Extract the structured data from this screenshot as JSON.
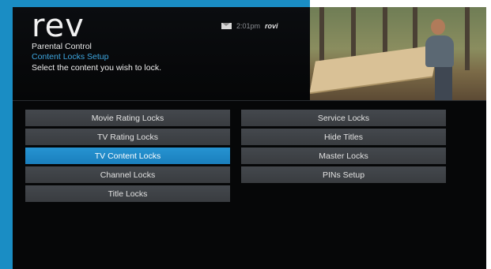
{
  "app": {
    "logo": "rev"
  },
  "header": {
    "breadcrumb_title": "Parental Control",
    "breadcrumb_subtitle": "Content Locks Setup",
    "instruction": "Select the content you wish to lock."
  },
  "status": {
    "time": "2:01pm",
    "brand": "rovi",
    "mail_icon": "mail-icon"
  },
  "menu": {
    "left": [
      {
        "label": "Movie Rating Locks",
        "selected": false
      },
      {
        "label": "TV Rating Locks",
        "selected": false
      },
      {
        "label": "TV Content Locks",
        "selected": true
      },
      {
        "label": "Channel Locks",
        "selected": false
      },
      {
        "label": "Title Locks",
        "selected": false
      }
    ],
    "right": [
      {
        "label": "Service Locks",
        "selected": false
      },
      {
        "label": "Hide Titles",
        "selected": false
      },
      {
        "label": "Master Locks",
        "selected": false
      },
      {
        "label": "PINs Setup",
        "selected": false
      }
    ]
  },
  "colors": {
    "accent": "#1a8dc4",
    "selected": "#2694d2",
    "background": "#060708",
    "item": "#3f4347",
    "subtitle": "#3ea7e0"
  }
}
